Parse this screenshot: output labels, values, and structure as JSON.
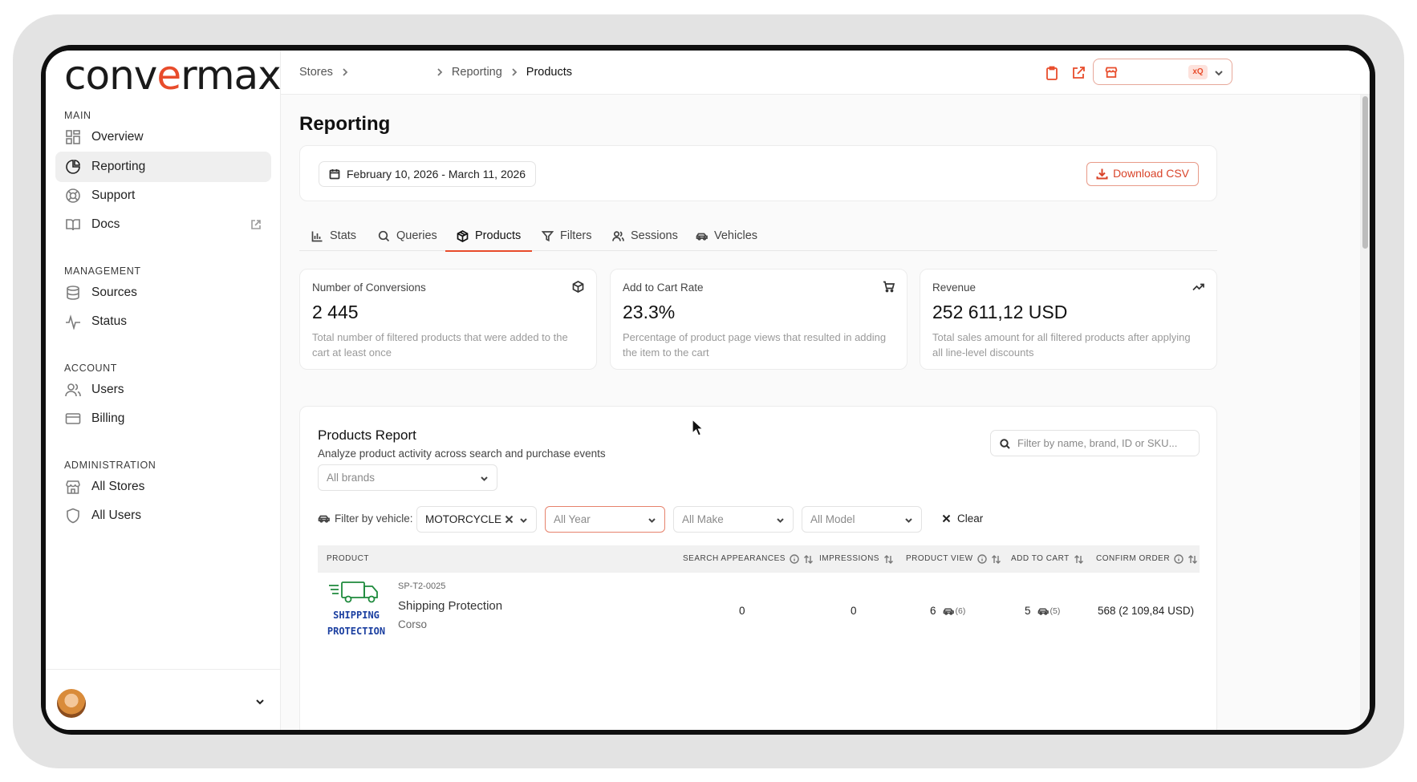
{
  "logo": {
    "text_prefix": "conv",
    "text_accent": "e",
    "text_suffix": "rmax"
  },
  "sidebar": {
    "sections": [
      {
        "title": "MAIN",
        "items": [
          {
            "label": "Overview",
            "icon": "grid-icon"
          },
          {
            "label": "Reporting",
            "icon": "pie-chart-icon",
            "active": true
          },
          {
            "label": "Support",
            "icon": "lifebuoy-icon"
          },
          {
            "label": "Docs",
            "icon": "book-icon",
            "external": true
          }
        ]
      },
      {
        "title": "MANAGEMENT",
        "items": [
          {
            "label": "Sources",
            "icon": "database-icon"
          },
          {
            "label": "Status",
            "icon": "activity-icon"
          }
        ]
      },
      {
        "title": "ACCOUNT",
        "items": [
          {
            "label": "Users",
            "icon": "users-icon"
          },
          {
            "label": "Billing",
            "icon": "credit-card-icon"
          }
        ]
      },
      {
        "title": "ADMINISTRATION",
        "items": [
          {
            "label": "All Stores",
            "icon": "store-icon"
          },
          {
            "label": "All Users",
            "icon": "shield-icon"
          }
        ]
      }
    ]
  },
  "breadcrumb": {
    "root": "Stores",
    "section": "Reporting",
    "current": "Products"
  },
  "store_selector": {
    "badge": "xQ"
  },
  "page_title": "Reporting",
  "date_range": "February 10, 2026 - March 11, 2026",
  "download_csv": "Download CSV",
  "tabs": [
    {
      "label": "Stats"
    },
    {
      "label": "Queries"
    },
    {
      "label": "Products",
      "active": true
    },
    {
      "label": "Filters"
    },
    {
      "label": "Sessions"
    },
    {
      "label": "Vehicles"
    }
  ],
  "stats": [
    {
      "label": "Number of Conversions",
      "value": "2 445",
      "desc": "Total number of filtered products that were added to the cart at least once",
      "icon": "box-icon"
    },
    {
      "label": "Add to Cart Rate",
      "value": "23.3%",
      "desc": "Percentage of product page views that resulted in adding the item to the cart",
      "icon": "cart-icon"
    },
    {
      "label": "Revenue",
      "value": "252 611,12 USD",
      "desc": "Total sales amount for all filtered products after applying all line-level discounts",
      "icon": "trending-up-icon"
    }
  ],
  "report": {
    "title": "Products Report",
    "subtitle": "Analyze product activity across search and purchase events",
    "search_placeholder": "Filter by name, brand, ID or SKU...",
    "brand_select": "All brands",
    "vehicle_label": "Filter by vehicle:",
    "vehicle_type": "MOTORCYCLE",
    "year_select": "All Year",
    "make_select": "All Make",
    "model_select": "All Model",
    "clear_label": "Clear",
    "columns": [
      "PRODUCT",
      "SEARCH APPEARANCES",
      "IMPRESSIONS",
      "PRODUCT VIEW",
      "ADD TO CART",
      "CONFIRM ORDER"
    ],
    "rows": [
      {
        "sku": "SP-T2-0025",
        "name": "Shipping Protection",
        "brand": "Corso",
        "image_text_1": "SHIPPING",
        "image_text_2": "PROTECTION",
        "search_appearances": "0",
        "impressions": "0",
        "product_view": "6",
        "product_view_vehicle": "(6)",
        "add_to_cart": "5",
        "add_to_cart_vehicle": "(5)",
        "confirm_order": "568 (2 109,84 USD)"
      }
    ]
  },
  "colors": {
    "accent": "#e84c2b",
    "brand_text": "#1a1a1a",
    "image_blue": "#1b3fa0",
    "image_green": "#1e8a3c"
  }
}
